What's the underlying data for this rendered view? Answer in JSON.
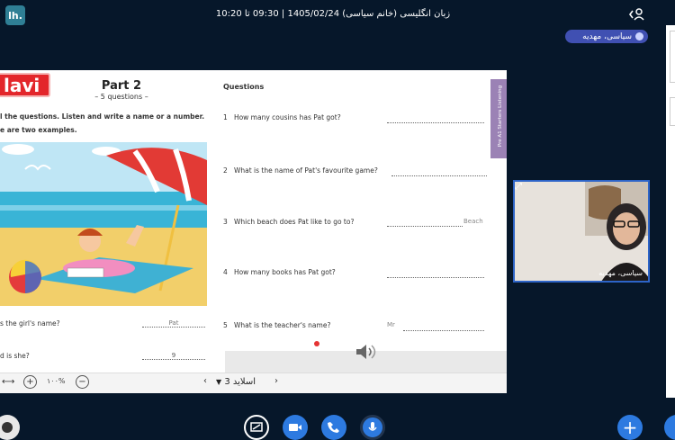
{
  "app": {
    "logo_text": "lh.",
    "meeting_title": "زبان انگلیسی (خانم سیاسی) 1405/02/24 | 09:30 تا 10:20",
    "presenter_name": "سیاسی، مهدیه"
  },
  "slide": {
    "brand": "lavi",
    "part_title": "Part 2",
    "part_subtitle": "– 5 questions –",
    "instruction_1": "l the questions. Listen and write a name or a number.",
    "instruction_2": "e are two examples.",
    "examples": [
      {
        "question": "s the girl's name?",
        "answer": "Pat"
      },
      {
        "question": "d is she?",
        "answer": "9"
      }
    ],
    "questions_heading": "Questions",
    "questions": [
      {
        "number": "1",
        "text": "How many cousins has Pat got?",
        "prefix": "",
        "suffix": ""
      },
      {
        "number": "2",
        "text": "What is the name of Pat's favourite game?",
        "prefix": "",
        "suffix": ""
      },
      {
        "number": "3",
        "text": "Which beach does Pat like to go to?",
        "prefix": "",
        "suffix": "Beach"
      },
      {
        "number": "4",
        "text": "How many books has Pat got?",
        "prefix": "",
        "suffix": ""
      },
      {
        "number": "5",
        "text": "What is the teacher's name?",
        "prefix": "Mr",
        "suffix": ""
      }
    ],
    "side_tab_text": "Pre A1 Starters Listening"
  },
  "toolbar": {
    "zoom_level": "۱۰۰%",
    "slide_selector": "اسلاید 3"
  },
  "webcam": {
    "participant_name": "سیاسی، مهدیه"
  },
  "colors": {
    "background": "#06172a",
    "accent_blue": "#2d7ae0",
    "badge": "#4050b2",
    "brand_red": "#e3262b"
  }
}
